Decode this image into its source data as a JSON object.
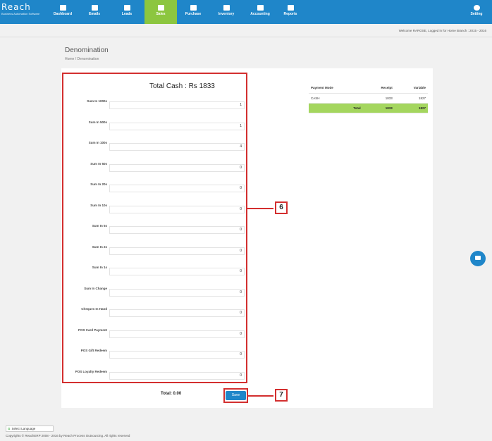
{
  "app": {
    "brand": "Reach",
    "tagline": "Business Automation Software"
  },
  "nav": {
    "items": [
      {
        "label": "Dashboard",
        "icon": "dashboard-icon"
      },
      {
        "label": "Emails",
        "icon": "email-icon"
      },
      {
        "label": "Leads",
        "icon": "leads-icon"
      },
      {
        "label": "Sales",
        "icon": "sales-chart-icon",
        "active": true
      },
      {
        "label": "Purchase",
        "icon": "purchase-icon"
      },
      {
        "label": "Inventory",
        "icon": "inventory-icon"
      },
      {
        "label": "Accounting",
        "icon": "accounting-icon"
      },
      {
        "label": "Reports",
        "icon": "reports-icon"
      }
    ],
    "setting_label": "Setting"
  },
  "welcome": "Welcome RAROSE, Logged in for Home Branch : 2015 - 2016",
  "page": {
    "title": "Denomination",
    "breadcrumb": "Home / Denomination"
  },
  "denomination": {
    "total_cash": "Total Cash : Rs 1833",
    "rows": [
      {
        "label": "Sum In 1000s",
        "value": "1"
      },
      {
        "label": "Sum In 500s",
        "value": "1"
      },
      {
        "label": "Sum In 100s",
        "value": "4"
      },
      {
        "label": "Sum In 50s",
        "value": "0"
      },
      {
        "label": "Sum In 20s",
        "value": "0"
      },
      {
        "label": "Sum In 10s",
        "value": "0"
      },
      {
        "label": "Sum In 5s",
        "value": "0"
      },
      {
        "label": "Sum In 2s",
        "value": "0"
      },
      {
        "label": "Sum In 1s",
        "value": "0"
      },
      {
        "label": "Sum In Change",
        "value": "0"
      },
      {
        "label": "Cheques In Hand",
        "value": "0"
      },
      {
        "label": "POS Card Payment",
        "value": "0"
      },
      {
        "label": "POS Gift Redeem",
        "value": "0"
      },
      {
        "label": "POS Loyalty Redeem",
        "value": "0"
      }
    ],
    "total_label": "Total: 0.00",
    "save_label": "Save"
  },
  "callouts": {
    "panel": "6",
    "save": "7"
  },
  "payment_table": {
    "headers": [
      "Payment Mode",
      "Receipt",
      "Variable"
    ],
    "rows": [
      [
        "CASH",
        "1833",
        "1827"
      ]
    ],
    "total": [
      "Total",
      "1833",
      "1827"
    ]
  },
  "colors": {
    "nav_bg": "#1f86c9",
    "nav_active": "#8cc63f",
    "highlight_red": "#d32f2f",
    "total_row": "#a4d65e"
  },
  "footer": {
    "language": "Select Language",
    "copyright": "Copyrights © ReachERP 2008 - 2016 by Reach Process Outsourcing. All rights reserved"
  }
}
